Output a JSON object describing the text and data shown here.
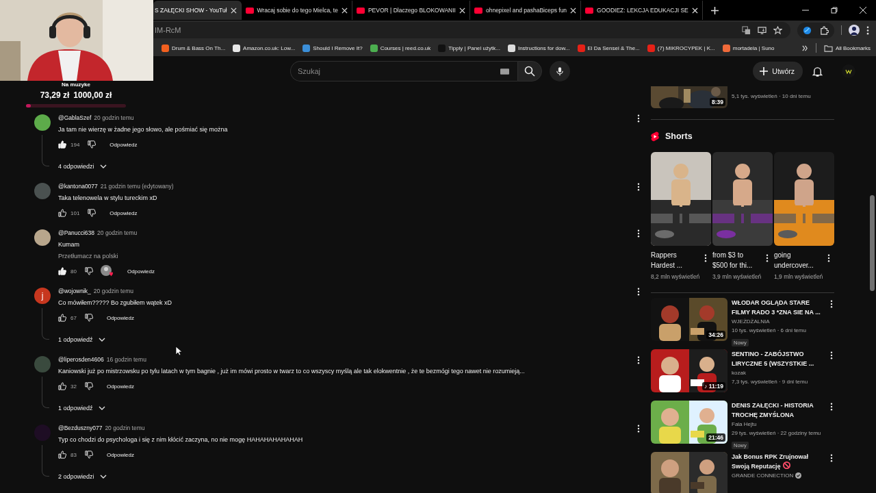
{
  "browser": {
    "tabs": [
      {
        "title": "S ZAŁĘCKI SHOW - YouTuł",
        "selected": true
      },
      {
        "title": "Wracaj sobie do tego Mielca, te",
        "selected": false
      },
      {
        "title": "PEVOR | Dlaczego BLOKOWANII",
        "selected": false
      },
      {
        "title": "ohnepixel and pashaBiceps fun",
        "selected": false
      },
      {
        "title": "GOODIEZ: LEKCJA EDUKACJI SE",
        "selected": false
      }
    ],
    "address": "IM-RcM",
    "bookmarks": [
      {
        "label": "Drum & Bass On Th...",
        "color": "#f2601f"
      },
      {
        "label": "Amazon.co.uk: Low...",
        "color": "#e8e8e8"
      },
      {
        "label": "Should I Remove It?",
        "color": "#3b8fd9"
      },
      {
        "label": "Courses | reed.co.uk",
        "color": "#4caf50"
      },
      {
        "label": "Tipply | Panel użytk...",
        "color": "#111111"
      },
      {
        "label": "Instructions for dow...",
        "color": "#dddddd"
      },
      {
        "label": "El Da Sensei & The...",
        "color": "#e62117"
      },
      {
        "label": "(7) MIKROCYPEK | K...",
        "color": "#e62117"
      },
      {
        "label": "mortadela | Suno",
        "color": "#f06a3a"
      }
    ],
    "all_bookmarks": "All Bookmarks"
  },
  "stream_goal": {
    "label": "Na muzyke",
    "amount": "73,29 zł",
    "target": "1000,00 zł",
    "level": 0.05
  },
  "header": {
    "search_placeholder": "Szukaj",
    "create": "Utwórz"
  },
  "comments": [
    {
      "author": "@GablaSzef",
      "time": "20 godzin temu",
      "text": "Ja tam nie wierzę w żadne jego słowo, ale pośmiać się można",
      "likes": "194",
      "liked": true,
      "reply": "Odpowiedz",
      "replies": "4 odpowiedzi"
    },
    {
      "author": "@kantona0077",
      "time": "21 godzin temu (edytowany)",
      "text": "Taka telenowela w stylu tureckim xD",
      "likes": "101",
      "liked": false,
      "reply": "Odpowiedz"
    },
    {
      "author": "@Panucci638",
      "time": "20 godzin temu",
      "text": "Kumam",
      "translate": "Przetłumacz na polski",
      "likes": "80",
      "liked": true,
      "creator_heart": true,
      "reply": "Odpowiedz"
    },
    {
      "author": "@wojownik_",
      "time": "20 godzin temu",
      "text": "Co mówiłem????? Bo zgubiłem wątek xD",
      "likes": "67",
      "liked": false,
      "reply": "Odpowiedz",
      "replies": "1 odpowiedź",
      "avatar_letter": "j"
    },
    {
      "author": "@liperosden4606",
      "time": "16 godzin temu",
      "text": "Kaniowski już po mistrzowsku po tylu latach w tym bagnie , już im mówi prosto w twarz to co wszyscy myślą ale tak elokwentnie , że te bezmógi tego nawet nie rozumieją...",
      "likes": "32",
      "liked": false,
      "reply": "Odpowiedz",
      "replies": "1 odpowiedź"
    },
    {
      "author": "@Bezduszny077",
      "time": "20 godzin temu",
      "text": "Typ co chodzi do psychologa i się z nim kłócić zaczyna, no nie mogę HAHAHAHAHAHAH",
      "likes": "83",
      "liked": false,
      "reply": "Odpowiedz",
      "replies": "2 odpowiedzi"
    }
  ],
  "sidebar": {
    "top_video": {
      "duration": "8:39",
      "meta": "5,1 tys. wyświetleń · 10 dni temu"
    },
    "shorts_title": "Shorts",
    "shorts": [
      {
        "title": "Rappers Hardest ...",
        "views": "8,2 mln wyświetleń"
      },
      {
        "title": "from $3 to $500 for thi...",
        "views": "3,9 mln wyświetleń"
      },
      {
        "title": "going undercover...",
        "views": "1,9 mln wyświetleń"
      }
    ],
    "videos": [
      {
        "title": "WŁODAR OGLĄDA STARE FILMY RADO 3 *ZNA SIE NA ...",
        "channel": "WJEŻDŻALNIA",
        "meta": "10 tys. wyświetleń · 6 dni temu",
        "duration": "34:26",
        "badge": "Nowy"
      },
      {
        "title": "SENTINO - ZABÓJSTWO LIRYCZNE 5 (WSZYSTKIE ...",
        "channel": "kozak",
        "meta": "7,3 tys. wyświetleń · 9 dni temu",
        "duration": "♪ 11:19"
      },
      {
        "title": "DENIS ZAŁĘCKI - HISTORIA TROCHĘ ZMYŚLONA",
        "channel": "Fala Hejtu",
        "meta": "29 tys. wyświetleń · 22 godziny temu",
        "duration": "21:46",
        "badge": "Nowy"
      },
      {
        "title": "Jak Bonus RPK Zrujnował Swoją Reputację",
        "banned_icon": true,
        "channel": "GRANDE CONNECTION",
        "verified": true
      }
    ]
  }
}
